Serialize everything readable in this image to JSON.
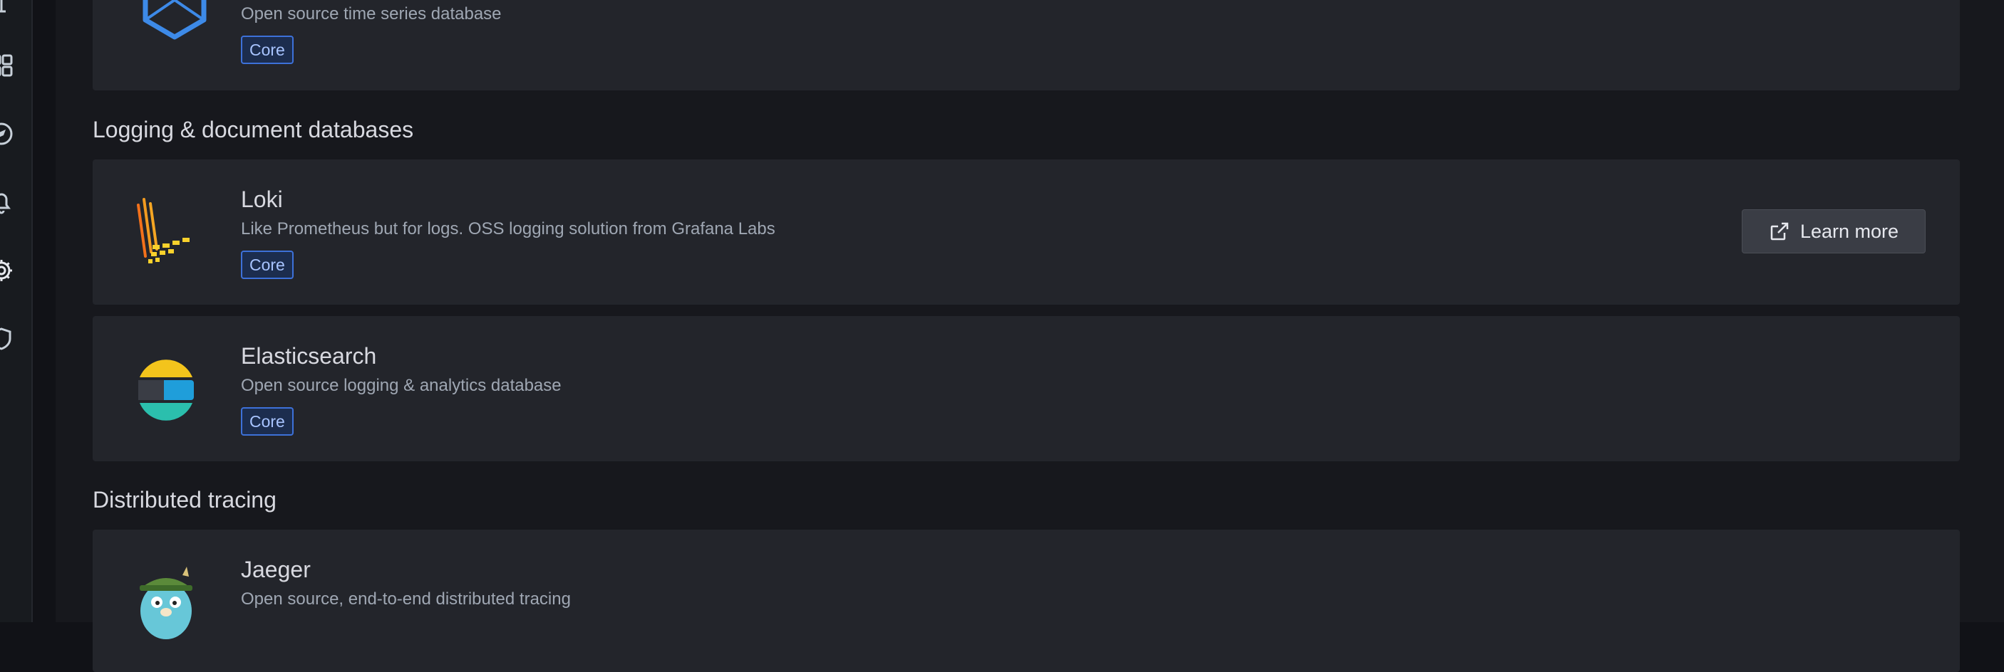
{
  "sidemenu": {
    "icons": [
      "dashboards-icon",
      "explore-icon",
      "alerting-icon",
      "configuration-icon",
      "shield-icon"
    ]
  },
  "cards": {
    "prometheus": {
      "description": "Open source time series database",
      "badge": "Core"
    },
    "loki": {
      "name": "Loki",
      "description": "Like Prometheus but for logs. OSS logging solution from Grafana Labs",
      "badge": "Core",
      "learn_more": "Learn more"
    },
    "elasticsearch": {
      "name": "Elasticsearch",
      "description": "Open source logging & analytics database",
      "badge": "Core"
    },
    "jaeger": {
      "name": "Jaeger",
      "description": "Open source, end-to-end distributed tracing"
    }
  },
  "sections": {
    "logging": "Logging & document databases",
    "tracing": "Distributed tracing"
  },
  "colors": {
    "background": "#17181d",
    "card": "#23252b",
    "badge_border": "#3d71d9",
    "prometheus_blue": "#3d8ae8",
    "loki_orange": "#f3711b",
    "loki_yellow": "#f8d12c"
  }
}
